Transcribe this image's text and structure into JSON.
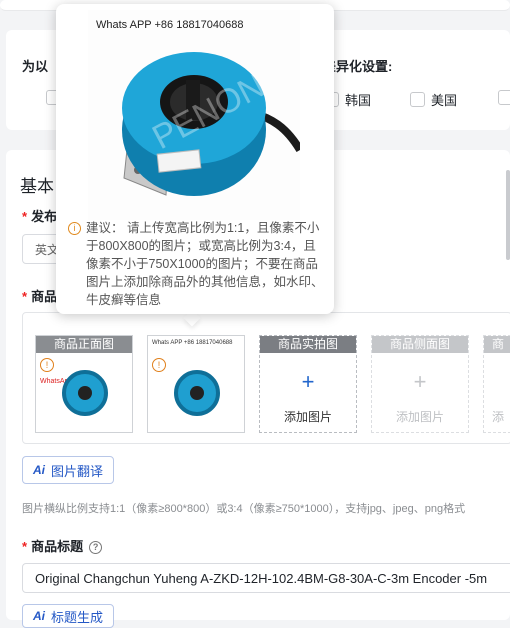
{
  "region": {
    "title": "为以下国家/地区的差异化设置:",
    "title_visible_left": "为以",
    "title_visible_right": "的差异化设置:",
    "options": [
      {
        "label": "韩国"
      },
      {
        "label": "美国"
      }
    ]
  },
  "basic": {
    "title": "基本",
    "publish_label": "发布",
    "publish_value": "英文",
    "product_label": "商品",
    "slots": [
      {
        "header": "商品正面图",
        "filled": true,
        "image_text": "WhatsApp",
        "image_note": "+86"
      },
      {
        "header": "",
        "filled": true,
        "image_text": "Whats APP +86 18817040688"
      },
      {
        "header": "商品实拍图",
        "filled": false,
        "add": "添加图片"
      },
      {
        "header": "商品侧面图",
        "filled": false,
        "add": "添加图片"
      },
      {
        "header": "商",
        "filled": false,
        "add": "添"
      }
    ],
    "image_translate_btn": "图片翻译",
    "image_hint": "图片横纵比例支持1:1（像素≥800*800）或3:4（像素≥750*1000），支持jpg、jpeg、png格式",
    "title_label": "商品标题",
    "title_value": "Original Changchun Yuheng A-ZKD-12H-102.4BM-G8-30A-C-3m Encoder -5m",
    "title_gen_btn": "标题生成"
  },
  "popover": {
    "caption": "Whats APP +86 18817040688",
    "tip": "建议： 请上传宽高比例为1:1，且像素不小于800X800的图片；或宽高比例为3:4，且像素不小于750X1000的图片；不要在商品图片上添加除商品外的其他信息，如水印、牛皮癣等信息",
    "watermark": "PENON"
  },
  "colors": {
    "accent": "#2458c6",
    "product_blue": "#1f9fd0",
    "required": "#ee2222"
  }
}
